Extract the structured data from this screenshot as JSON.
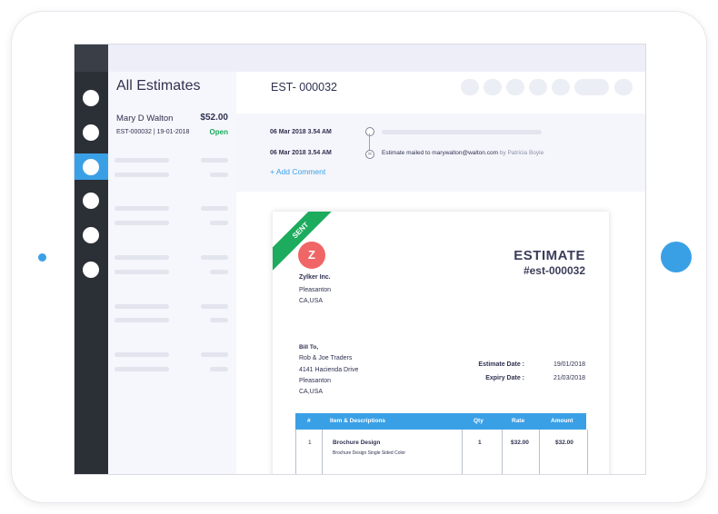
{
  "colors": {
    "accent": "#3aa0e6",
    "status_open": "#1dab5d",
    "sidebar": "#2b2f36",
    "logo": "#f06666"
  },
  "sidebar": {
    "icons": [
      "nav-dot-icon",
      "nav-dot-icon",
      "nav-dot-icon",
      "nav-dot-icon",
      "nav-dot-icon",
      "nav-dot-icon"
    ],
    "active_index": 2
  },
  "list": {
    "title": "All Estimates",
    "items": [
      {
        "customer": "Mary D Walton",
        "amount": "$52.00",
        "number": "EST-000032 | 19-01-2018",
        "status": "Open"
      }
    ]
  },
  "detail": {
    "title": "EST- 000032",
    "activity": [
      {
        "time": "06 Mar 2018 3.54 AM",
        "text": ""
      },
      {
        "time": "06 Mar 2018 3.54 AM",
        "text": "Estimate mailed to marywalton@walton.com",
        "by": "by Patricia Boyle"
      }
    ],
    "add_comment": "+ Add Comment"
  },
  "estimate": {
    "ribbon": "SENT",
    "logo_letter": "Z",
    "company": "Zylker Inc.",
    "company_addr": [
      "Pleasanton",
      "CA,USA"
    ],
    "heading": "ESTIMATE",
    "code": "#est-000032",
    "bill_to_label": "Bill To,",
    "bill_to": [
      "Rob & Joe Traders",
      "4141 Hacienda Drive",
      "Pleasanton",
      "CA,USA"
    ],
    "estimate_date_label": "Estimate Date :",
    "estimate_date": "19/01/2018",
    "expiry_date_label": "Expiry Date :",
    "expiry_date": "21/03/2018",
    "columns": [
      "#",
      "Item & Descriptions",
      "Qty",
      "Rate",
      "Amount"
    ],
    "rows": [
      {
        "num": "1",
        "item": "Brochure Design",
        "desc": "Brochure Design Single Sided Color",
        "qty": "1",
        "rate": "$32.00",
        "amount": "$32.00"
      }
    ]
  }
}
